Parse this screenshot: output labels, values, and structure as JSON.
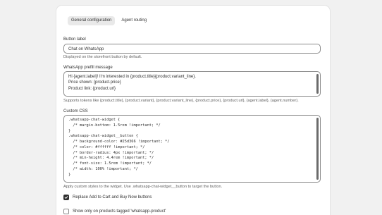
{
  "tabs": [
    {
      "label": "General configuration",
      "active": true
    },
    {
      "label": "Agent routing",
      "active": false
    }
  ],
  "button_label": {
    "label": "Button label",
    "value": "Chat on WhatsApp",
    "help": "Displayed on the storefront button by default."
  },
  "prefill": {
    "label": "WhatsApp prefill message",
    "lines": [
      "Hi {agent.label}! I'm interested in {product.title}{product.variant_line}.",
      "Price shown: {product.price}",
      "Product link: {product.url}"
    ],
    "help": "Supports tokens like {product.title}, {product.variant}, {product.variant_line}, {product.price}, {product.url}, {agent.label}, {agent.number}."
  },
  "custom_css": {
    "label": "Custom CSS",
    "lines": [
      ".whatsapp-chat-widget {",
      "  /* margin-bottom: 1.5rem !important; */",
      "}",
      ".whatsapp-chat-widget__button {",
      "  /* background-color: #25d366 !important; */",
      "  /* color: #ffffff !important; */",
      "  /* border-radius: 4px !important; */",
      "  /* min-height: 4.4rem !important; */",
      "  /* font-size: 1.5rem !important; */",
      "  /* width: 100% !important; */",
      "}"
    ],
    "help": "Apply custom styles to the widget. Use .whatsapp-chat-widget__button to target the button."
  },
  "options": [
    {
      "label": "Replace Add to Cart and Buy Now buttons",
      "checked": true
    },
    {
      "label": "Show only on products tagged 'whatsapp-product'",
      "checked": false
    }
  ],
  "colors": {
    "page_bg": "#f1f1f1",
    "card_bg": "#ffffff",
    "active_tab_bg": "#e9e9e9",
    "checkbox_checked": "#303030"
  }
}
